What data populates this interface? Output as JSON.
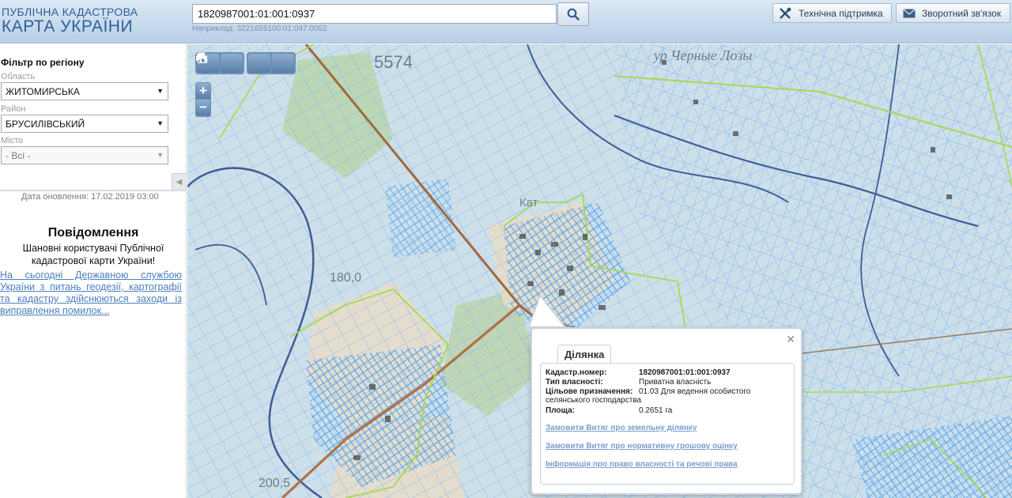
{
  "header": {
    "logo_top": "ПУБЛІЧНА КАДАСТРОВА",
    "logo_bottom": "КАРТА УКРАЇНИ",
    "search_value": "1820987001:01:001:0937",
    "search_hint": "Наприклад: 3221655100:01:047:0052",
    "support_label": "Технічна підтримка",
    "feedback_label": "Зворотний зв'язок"
  },
  "sidebar": {
    "filter_title": "Фільтр по регіону",
    "oblast_label": "Область",
    "oblast_value": "ЖИТОМИРСЬКА",
    "rayon_label": "Район",
    "rayon_value": "БРУСИЛІВСЬКИЙ",
    "misto_label": "Місто",
    "misto_value": "- Всі -",
    "update_date": "Дата оновлення: 17.02.2019 03:00",
    "notice_title": "Повідомлення",
    "notice_body": "Шановні користувачі Публічної кадастрової карти України!",
    "notice_link": "На сьогодні Державною службою України з питань геодезії, картографії та кадастру здійснюються заходи із виправлення помилок..."
  },
  "map": {
    "labels": {
      "top_number": "5574",
      "place_top": "ур Черные Лозы",
      "elevation_1": "180,0",
      "elevation_2": "200,5",
      "village": "Кат"
    }
  },
  "popup": {
    "tab_label": "Ділянка",
    "rows": [
      {
        "key": "Кадастр.номер:",
        "value": "1820987001:01:001:0937"
      },
      {
        "key": "Тип власності:",
        "value": "Приватна власність"
      },
      {
        "key": "Цільове призначення:",
        "value": "01.03 Для ведення особистого селянського господарства"
      },
      {
        "key": "Площа:",
        "value": "0.2651 га"
      }
    ],
    "links": [
      "Замовити Витяг про земельну ділянку",
      "Замовити Витяг про нормативну грошову оцінку",
      "Інформація про право власності та речові права"
    ]
  },
  "colors": {
    "parcel_line": "#7ab6f2",
    "boundary_line": "#a8d84e",
    "road": "#a0693c",
    "river": "#3f5d93",
    "link": "#7c9dd0"
  }
}
